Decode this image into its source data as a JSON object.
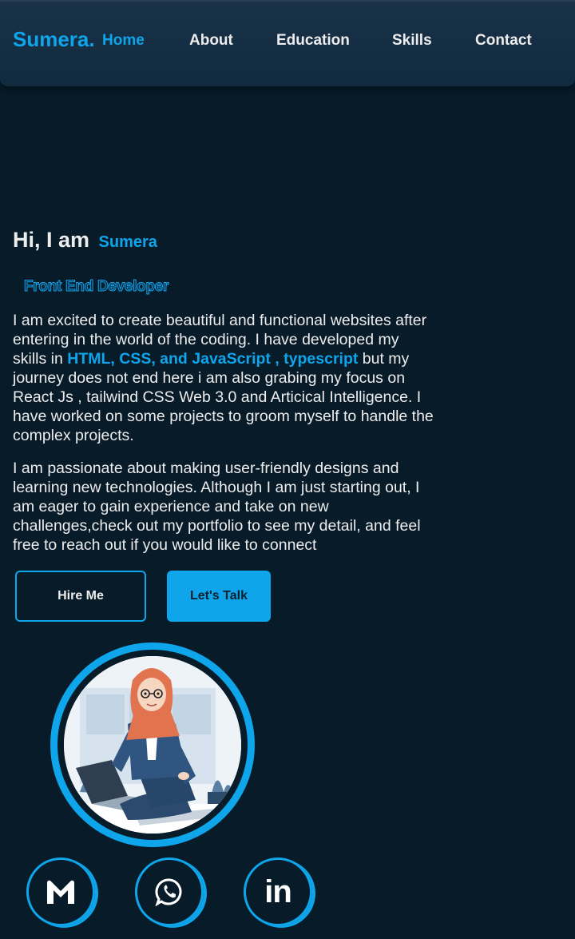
{
  "header": {
    "logo": "Sumera.",
    "nav": [
      {
        "label": "Home",
        "active": true
      },
      {
        "label": "About",
        "active": false
      },
      {
        "label": "Education",
        "active": false
      },
      {
        "label": "Skills",
        "active": false
      },
      {
        "label": "Contact",
        "active": false
      }
    ]
  },
  "hero": {
    "greeting": "Hi, I am",
    "name": "Sumera",
    "role": "Front End Developer",
    "para1_before": "I am excited to create beautiful and functional websites after entering in the world of the coding. I have developed my skills in ",
    "para1_highlight": "HTML, CSS, and JavaScript , typescript",
    "para1_after": " but my journey does not end here i am also grabing my focus on React Js , tailwind CSS Web 3.0 and Articical Intelligence. I have worked on some projects to groom myself to handle the complex projects.",
    "para2": "I am passionate about making user-friendly designs and learning new technologies. Although I am just starting out, I am eager to gain experience and take on new challenges,check out my portfolio to see my detail, and feel free to reach out if you would like to connect",
    "buttons": {
      "hire": "Hire Me",
      "talk": "Let's Talk"
    }
  },
  "social": {
    "gmail_icon": "gmail-icon",
    "whatsapp_icon": "whatsapp-icon",
    "linkedin_icon": "linkedin-icon",
    "linkedin_text": "in"
  },
  "colors": {
    "accent": "#0ea5ea",
    "background": "#081b29",
    "header": "#15304a",
    "text": "#ededed"
  }
}
